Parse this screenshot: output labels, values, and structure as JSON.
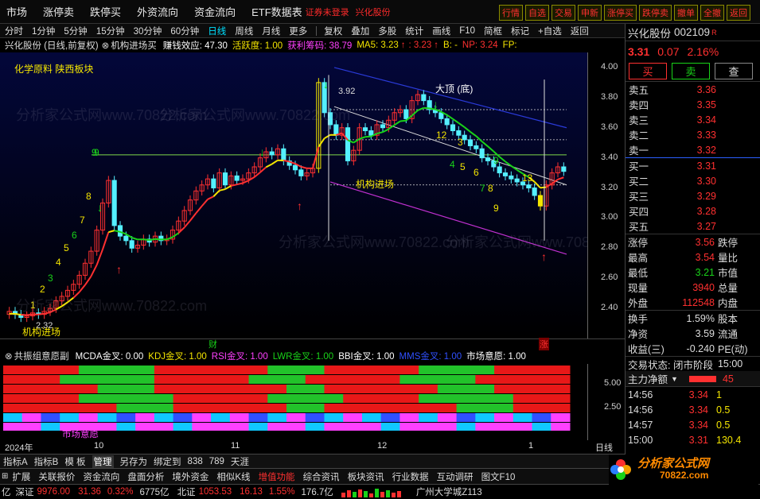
{
  "top_menu": [
    "市场",
    "涨停卖",
    "跌停买",
    "外资流向",
    "资金流向",
    "ETF数据表"
  ],
  "top_warning": "证券未登录",
  "top_stock": "兴化股份",
  "right_buttons": [
    "行情",
    "自选",
    "交易",
    "申新",
    "涨停买",
    "跌停卖",
    "撤单",
    "全撤",
    "返回"
  ],
  "toolbar": [
    "分时",
    "1分钟",
    "5分钟",
    "15分钟",
    "30分钟",
    "60分钟",
    "日线",
    "周线",
    "月线",
    "更多",
    "复权",
    "叠加",
    "多股",
    "统计",
    "画线",
    "F10",
    "简框",
    "标记",
    "+自选",
    "返回"
  ],
  "info": {
    "stock": "兴化股份 (日线,前复权)",
    "indicator": "机构进场买",
    "zqxy_label": "赚钱效应: 47.30",
    "hyd_label": "活跃度: 1.00",
    "hlcm_label": "获利筹码: 38.79",
    "ma5_label": "MA5: 3.23",
    "v2": ": 3.23",
    "b_label": "B: -",
    "np_label": "NP: 3.24",
    "fp_label": "FP:"
  },
  "chart_labels": {
    "sector": "化学原料  陕西板块",
    "high_price": "3.92",
    "low_price": "2.32",
    "big_top": "大顶 (底)",
    "inst_entry": "机构进场",
    "cai": "财",
    "zhang": "涨",
    "counts": [
      "9",
      "8",
      "7",
      "6",
      "5",
      "4",
      "3",
      "2",
      "1",
      "9",
      "12",
      "3",
      "4",
      "5",
      "6",
      "7",
      "8",
      "9",
      "9",
      "13"
    ],
    "watermark": "分析家公式网www.70822.com"
  },
  "chart_data": {
    "type": "candlestick",
    "ylim": [
      2.2,
      4.1
    ],
    "yticks": [
      "4.00",
      "3.80",
      "3.60",
      "3.40",
      "3.20",
      "3.00",
      "2.80",
      "2.60",
      "2.40"
    ],
    "xticks": [
      "2024年",
      "10",
      "11",
      "12",
      "1"
    ],
    "period": "日线"
  },
  "indicator_bar": {
    "title": "共振组意愿副",
    "items": [
      {
        "label": "MCDA金叉: 0.00",
        "color": "#ffffff"
      },
      {
        "label": "KDJ金叉: 1.00",
        "color": "#f4e500"
      },
      {
        "label": "RSI金叉: 1.00",
        "color": "#ff40ff"
      },
      {
        "label": "LWR金叉: 1.00",
        "color": "#19d219"
      },
      {
        "label": "BBI金叉: 1.00",
        "color": "#ffffff"
      },
      {
        "label": "MMS金叉: 1.00",
        "color": "#3050ff"
      },
      {
        "label": "市场意愿: 1.00",
        "color": "#ffffff"
      }
    ],
    "yticks": [
      "5.00",
      "2.50"
    ],
    "market_will": "市场意愿"
  },
  "bottom_tabs": [
    "指标A",
    "指标B",
    "模 板",
    "管理",
    "另存为",
    "绑定到",
    "838",
    "789",
    "天涯"
  ],
  "info_bar": [
    "扩展",
    "关联报价",
    "资金流向",
    "盘面分析",
    "境外资金",
    "相似K线",
    "增值功能",
    "综合资讯",
    "板块资讯",
    "行业数据",
    "互动调研",
    "图文F10"
  ],
  "status": {
    "left": "亿",
    "sz_label": "深证",
    "sz_val": "9976.00",
    "sz_chg": "31.36",
    "sz_pct": "0.32%",
    "sz_amt": "6775亿",
    "bz_label": "北证",
    "bz_val": "1053.53",
    "bz_chg": "16.13",
    "bz_pct": "1.55%",
    "bz_amt": "176.7亿",
    "location": "广州大学城Z113"
  },
  "quote": {
    "name": "兴化股份",
    "code": "002109",
    "r": "R",
    "price": "3.31",
    "chg": "0.07",
    "pct": "2.16%",
    "buy": "买",
    "sell": "卖",
    "query": "查",
    "asks": [
      {
        "label": "卖五",
        "price": "3.36"
      },
      {
        "label": "卖四",
        "price": "3.35"
      },
      {
        "label": "卖三",
        "price": "3.34"
      },
      {
        "label": "卖二",
        "price": "3.33"
      },
      {
        "label": "卖一",
        "price": "3.32"
      }
    ],
    "bids": [
      {
        "label": "买一",
        "price": "3.31"
      },
      {
        "label": "买二",
        "price": "3.30"
      },
      {
        "label": "买三",
        "price": "3.29"
      },
      {
        "label": "买四",
        "price": "3.28"
      },
      {
        "label": "买五",
        "price": "3.27"
      }
    ],
    "stats": [
      {
        "l": "涨停",
        "v": "3.56",
        "r": "跌停",
        "c": "red"
      },
      {
        "l": "最高",
        "v": "3.54",
        "r": "量比",
        "c": "red"
      },
      {
        "l": "最低",
        "v": "3.21",
        "r": "市值",
        "c": "grn"
      },
      {
        "l": "现量",
        "v": "3940",
        "r": "总量",
        "c": "red"
      },
      {
        "l": "外盘",
        "v": "112548",
        "r": "内盘",
        "c": "red"
      }
    ],
    "stats2": [
      {
        "l": "换手",
        "v": "1.59%",
        "r": "股本",
        "c": "wht"
      },
      {
        "l": "净资",
        "v": "3.59",
        "r": "流通",
        "c": "wht"
      },
      {
        "l": "收益(三)",
        "v": "-0.240",
        "r": "PE(动)",
        "c": "wht"
      }
    ],
    "trade_state": "交易状态: 闭市阶段",
    "time": "15:00",
    "main_flow_label": "主力净额",
    "main_flow_val": "45",
    "ticks": [
      {
        "t": "14:56",
        "p": "3.34",
        "v": "1"
      },
      {
        "t": "14:56",
        "p": "3.34",
        "v": "0.5"
      },
      {
        "t": "14:57",
        "p": "3.34",
        "v": "0.5"
      },
      {
        "t": "15:00",
        "p": "3.31",
        "v": "130.4"
      }
    ]
  },
  "logo": {
    "name": "分析家公式网",
    "url": "70822.com"
  }
}
